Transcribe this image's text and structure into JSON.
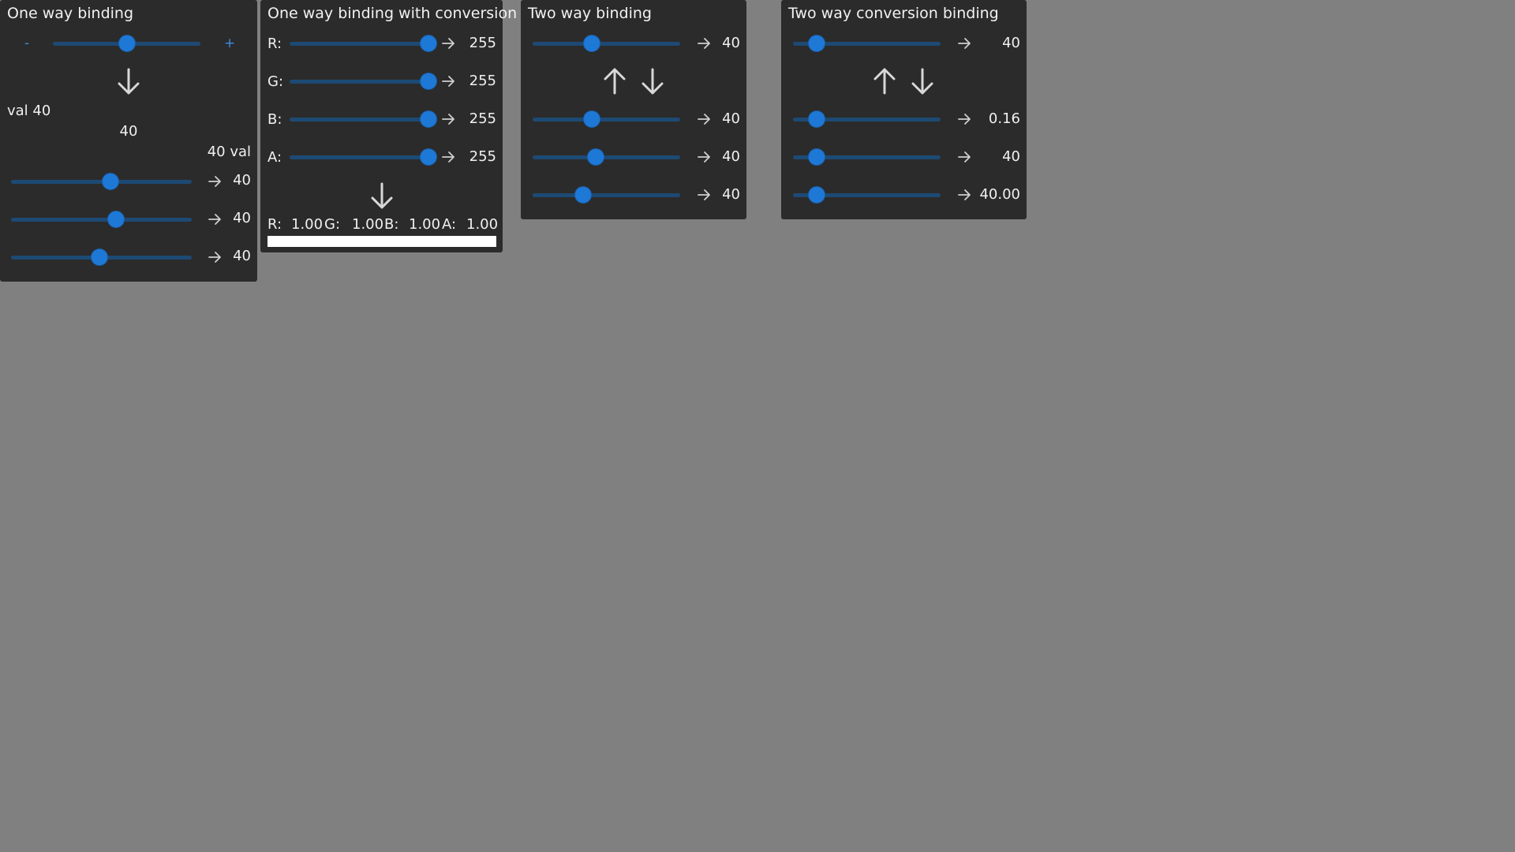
{
  "panel1": {
    "title": "One way binding",
    "minus": "-",
    "plus": "+",
    "slider_value": 40,
    "slider_max": 100,
    "text_left": "val 40",
    "text_center": "40",
    "text_right": "40 val",
    "rows": [
      {
        "value": "40",
        "slider": 40
      },
      {
        "value": "40",
        "slider": 43
      },
      {
        "value": "40",
        "slider": 34
      }
    ]
  },
  "panel2": {
    "title": "One way binding with conversion",
    "rows": [
      {
        "label": "R:",
        "value": "255",
        "slider": 255
      },
      {
        "label": "G:",
        "value": "255",
        "slider": 255
      },
      {
        "label": "B:",
        "value": "255",
        "slider": 255
      },
      {
        "label": "A:",
        "value": "255",
        "slider": 255
      }
    ],
    "summary": [
      {
        "label": "R:",
        "value": "1.00"
      },
      {
        "label": "G:",
        "value": "1.00"
      },
      {
        "label": "B:",
        "value": "1.00"
      },
      {
        "label": "A:",
        "value": "1.00"
      }
    ],
    "color": "#ffffff"
  },
  "panel3": {
    "title": "Two way binding",
    "top": {
      "value": "40",
      "slider": 40
    },
    "rows": [
      {
        "value": "40",
        "slider": 40
      },
      {
        "value": "40",
        "slider": 43
      },
      {
        "value": "40",
        "slider": 34
      }
    ]
  },
  "panel4": {
    "title": "Two way conversion binding",
    "top": {
      "value": "40",
      "slider": 16
    },
    "rows": [
      {
        "value": "0.16",
        "slider": 16
      },
      {
        "value": "40",
        "slider": 16
      },
      {
        "value": "40.00",
        "slider": 16
      }
    ]
  },
  "colors": {
    "background": "#808080",
    "panel": "#2b2b2b",
    "accent": "#1e78d6",
    "track": "#1d4a74"
  }
}
